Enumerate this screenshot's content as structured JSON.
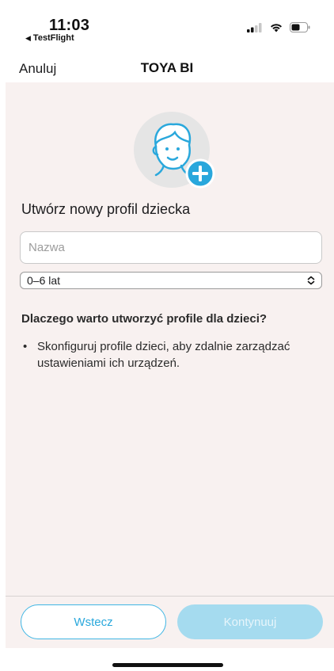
{
  "status_bar": {
    "time": "11:03",
    "back_app": "TestFlight",
    "back_arrow": "◀"
  },
  "nav": {
    "cancel_label": "Anuluj",
    "title": "TOYA BI"
  },
  "form": {
    "heading": "Utwórz nowy profil dziecka",
    "name_placeholder": "Nazwa",
    "name_value": "",
    "age_selected": "0–6 lat"
  },
  "info": {
    "title": "Dlaczego warto utworzyć profile dla dzieci?",
    "bullet": "Skonfiguruj profile dzieci, aby zdalnie zarządzać ustawieniami ich urządzeń."
  },
  "footer": {
    "back_label": "Wstecz",
    "continue_label": "Kontynuuj"
  },
  "colors": {
    "accent": "#40b6e4",
    "accent_disabled": "#a5dbef",
    "content_bg": "#f8f1f0"
  }
}
